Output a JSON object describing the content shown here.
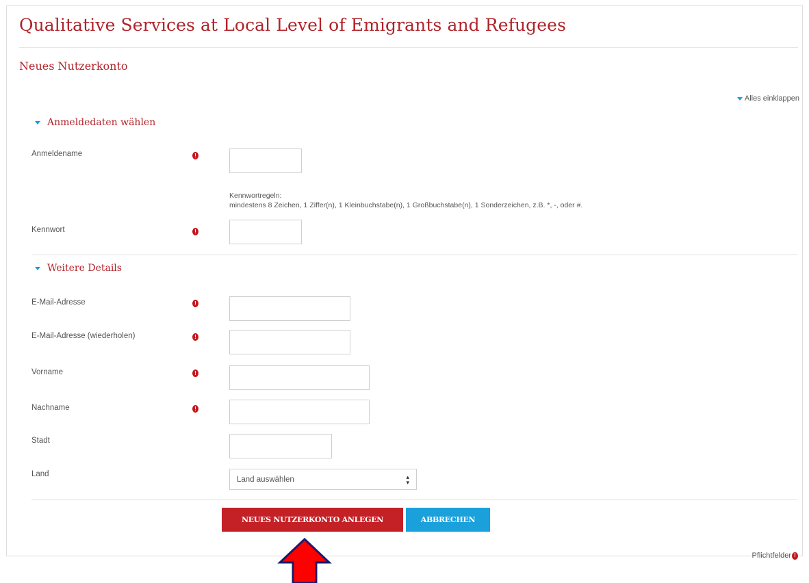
{
  "site_title": "Qualitative Services at Local Level of Emigrants and Refugees",
  "page_heading": "Neues Nutzerkonto",
  "collapse_all": "Alles einklappen",
  "sections": {
    "login": {
      "title": "Anmeldedaten wählen",
      "username_label": "Anmeldename",
      "password_rules_title": "Kennwortregeln:",
      "password_rules_text": "mindestens 8 Zeichen, 1 Ziffer(n), 1 Kleinbuchstabe(n), 1 Großbuchstabe(n), 1 Sonderzeichen, z.B. *, -, oder #.",
      "password_label": "Kennwort"
    },
    "details": {
      "title": "Weitere Details",
      "email_label": "E-Mail-Adresse",
      "email_repeat_label": "E-Mail-Adresse (wiederholen)",
      "firstname_label": "Vorname",
      "lastname_label": "Nachname",
      "city_label": "Stadt",
      "country_label": "Land",
      "country_selected": "Land auswählen"
    }
  },
  "buttons": {
    "create": "NEUES NUTZERKONTO ANLEGEN",
    "cancel": "ABBRECHEN"
  },
  "required_note": "Pflichtfelder",
  "required_icon_glyph": "!",
  "colors": {
    "brand_red": "#b1232a",
    "primary_button": "#c42127",
    "cancel_button": "#1aa1dc",
    "required_icon": "#c5161d",
    "collapse_triangle": "#1f9ad6",
    "annotation_arrow": "#ff0000"
  }
}
